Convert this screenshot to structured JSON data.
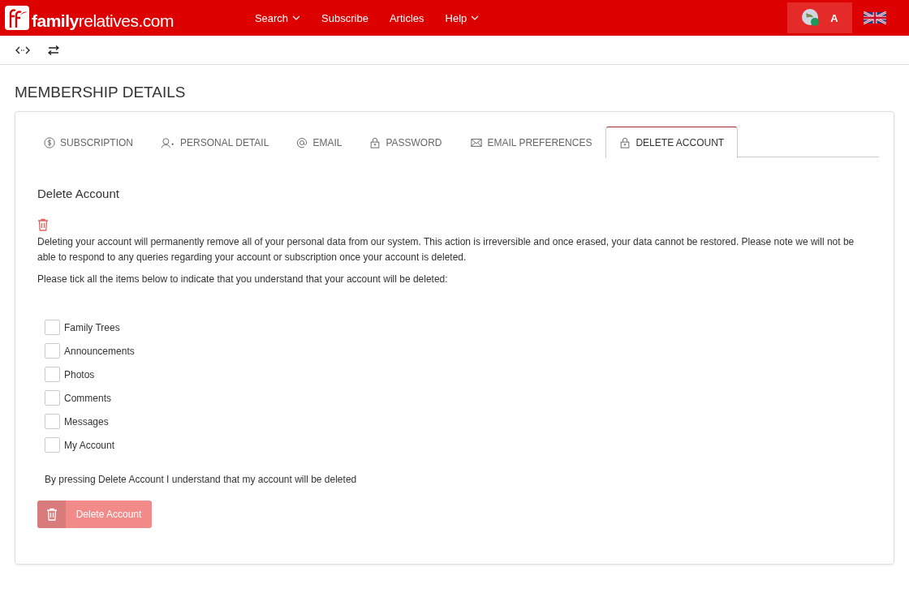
{
  "header": {
    "logo": "**family**relatives.com",
    "nav": [
      {
        "label": "Search",
        "dropdown": true
      },
      {
        "label": "Subscribe",
        "dropdown": false
      },
      {
        "label": "Articles",
        "dropdown": false
      },
      {
        "label": "Help",
        "dropdown": true
      }
    ],
    "user": {
      "initial": "A",
      "online": true
    }
  },
  "page_title": "MEMBERSHIP DETAILS",
  "tabs": [
    {
      "label": "SUBSCRIPTION",
      "kind": "dollar",
      "selected": false
    },
    {
      "label": "PERSONAL DETAIL",
      "kind": "person",
      "selected": false
    },
    {
      "label": "EMAIL",
      "kind": "at",
      "selected": false
    },
    {
      "label": "PASSWORD",
      "kind": "lock",
      "selected": false
    },
    {
      "label": "EMAIL PREFERENCES",
      "kind": "mail",
      "selected": false
    },
    {
      "label": "DELETE ACCOUNT",
      "kind": "lock",
      "selected": true
    }
  ],
  "section": {
    "heading": "Delete Account",
    "warning": "Deleting your account will permanently remove all of your personal data from our system. This action is irreversible and once erased, your data cannot be restored. Please note we will not be able to respond to any queries regarding your account or subscription once your account is deleted.",
    "instruction": "Please tick all the items below to indicate that you understand that your account will be deleted:",
    "items": [
      {
        "label": "Family Trees",
        "checked": false
      },
      {
        "label": "Announcements",
        "checked": false
      },
      {
        "label": "Photos",
        "checked": false
      },
      {
        "label": "Comments",
        "checked": false
      },
      {
        "label": "Messages",
        "checked": false
      },
      {
        "label": "My Account",
        "checked": false
      }
    ],
    "confirmation": "By pressing Delete Account I understand that my account will be deleted",
    "button": {
      "label": "Delete Account",
      "disabled": true
    }
  }
}
